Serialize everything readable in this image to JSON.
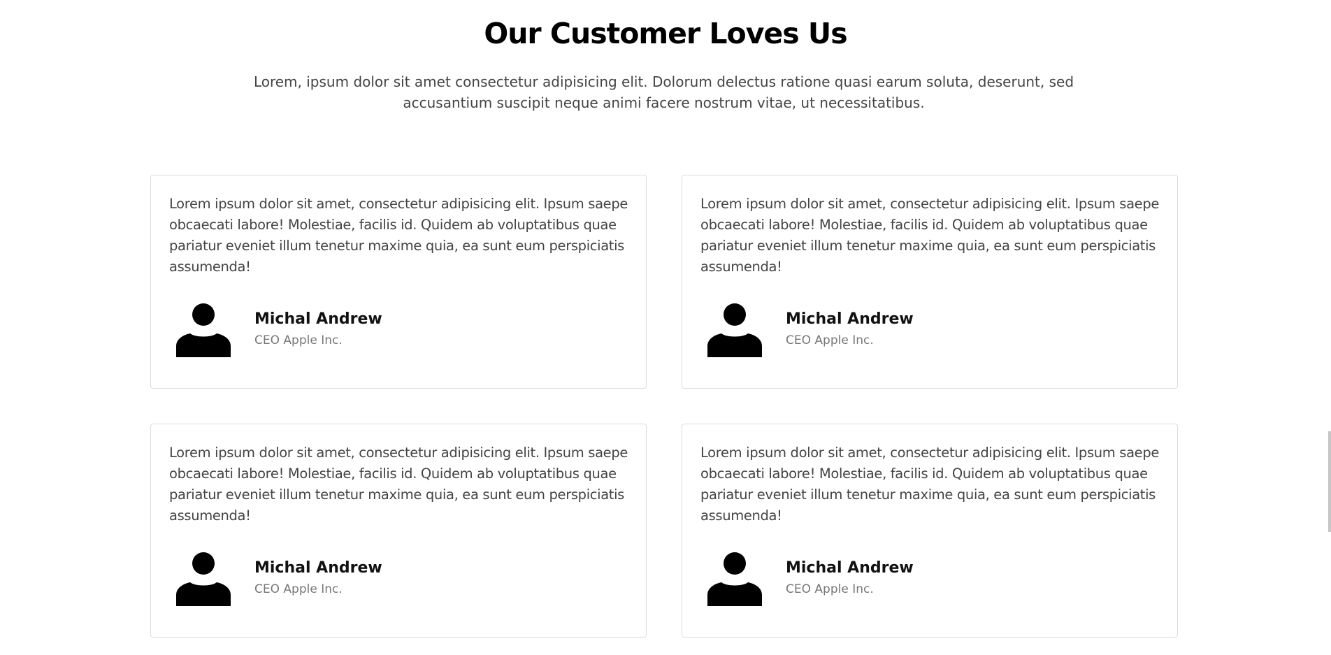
{
  "section": {
    "title": "Our Customer Loves Us",
    "subtitle": "Lorem, ipsum dolor sit amet consectetur adipisicing elit. Dolorum delectus ratione quasi earum soluta, deserunt, sed accusantium suscipit neque animi facere nostrum vitae, ut necessitatibus."
  },
  "testimonials": [
    {
      "text": "Lorem ipsum dolor sit amet, consectetur adipisicing elit. Ipsum saepe obcaecati labore! Molestiae, facilis id. Quidem ab voluptatibus quae pariatur eveniet illum tenetur maxime quia, ea sunt eum perspiciatis assumenda!",
      "name": "Michal Andrew",
      "role": "CEO Apple Inc.",
      "avatar_icon": "user-silhouette-icon"
    },
    {
      "text": "Lorem ipsum dolor sit amet, consectetur adipisicing elit. Ipsum saepe obcaecati labore! Molestiae, facilis id. Quidem ab voluptatibus quae pariatur eveniet illum tenetur maxime quia, ea sunt eum perspiciatis assumenda!",
      "name": "Michal Andrew",
      "role": "CEO Apple Inc.",
      "avatar_icon": "user-silhouette-icon"
    },
    {
      "text": "Lorem ipsum dolor sit amet, consectetur adipisicing elit. Ipsum saepe obcaecati labore! Molestiae, facilis id. Quidem ab voluptatibus quae pariatur eveniet illum tenetur maxime quia, ea sunt eum perspiciatis assumenda!",
      "name": "Michal Andrew",
      "role": "CEO Apple Inc.",
      "avatar_icon": "user-silhouette-icon"
    },
    {
      "text": "Lorem ipsum dolor sit amet, consectetur adipisicing elit. Ipsum saepe obcaecati labore! Molestiae, facilis id. Quidem ab voluptatibus quae pariatur eveniet illum tenetur maxime quia, ea sunt eum perspiciatis assumenda!",
      "name": "Michal Andrew",
      "role": "CEO Apple Inc.",
      "avatar_icon": "user-silhouette-icon"
    }
  ],
  "colors": {
    "heading": "#000000",
    "body_text": "#444444",
    "muted_text": "#777777",
    "card_border": "#dcdcdc"
  }
}
